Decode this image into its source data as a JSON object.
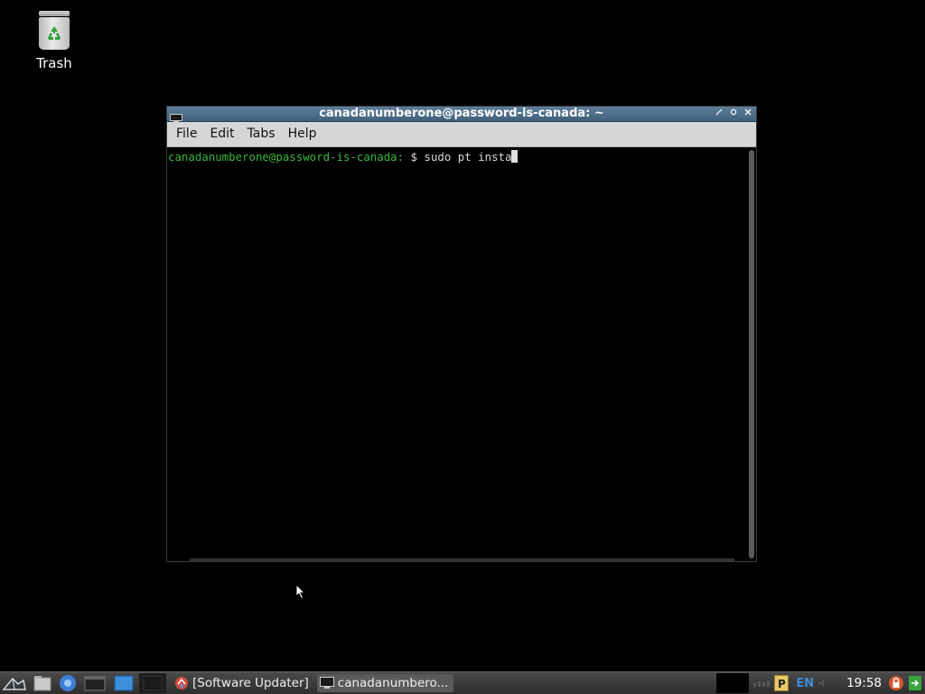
{
  "desktop": {
    "trash_label": "Trash"
  },
  "window": {
    "title": "canadanumberone@password-is-canada: ~",
    "menu": [
      "File",
      "Edit",
      "Tabs",
      "Help"
    ],
    "terminal": {
      "prompt": "canadanumberone@password-is-canada:",
      "symbol": " $ ",
      "command": "sudo pt insta"
    }
  },
  "taskbar": {
    "tasks": [
      {
        "label": "[Software Updater]",
        "icon": "software-updater-icon"
      },
      {
        "label": "canadanumbero...",
        "icon": "terminal-icon"
      }
    ],
    "lang": "EN",
    "clock": "19:58"
  },
  "colors": {
    "titlebar": "#4a6a88",
    "prompt_green": "#38b83a",
    "taskbar": "#3a3a3a"
  }
}
